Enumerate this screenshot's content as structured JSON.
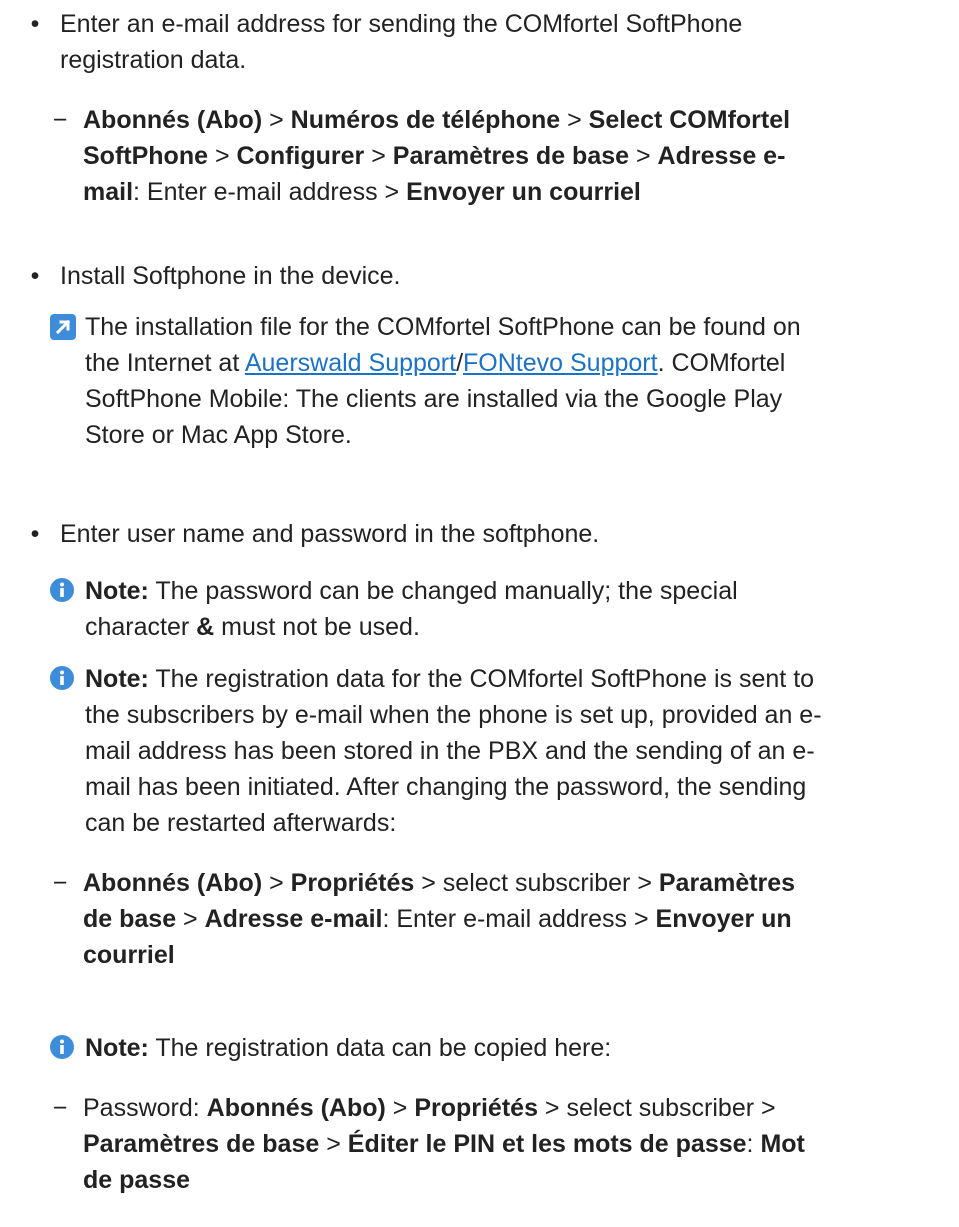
{
  "item1": {
    "bullet": "•",
    "text_line1": "Enter an e-mail address for sending the COMfortel SoftPhone",
    "text_line2": "registration data.",
    "dash": "−",
    "path": {
      "l1_p1": "Abonnés (Abo)",
      "l1_p2": " > ",
      "l1_p3": "Numéros de téléphone",
      "l1_p4": " > ",
      "l1_p5": "Select COMfortel",
      "l2_p1": "SoftPhone",
      "l2_p2": " > ",
      "l2_p3": "Configurer",
      "l2_p4": " > ",
      "l2_p5": "Paramètres de base",
      "l2_p6": " > ",
      "l2_p7": "Adresse e-",
      "l3_p1": "mail",
      "l3_p2": ": Enter e-mail address > ",
      "l3_p3": "Envoyer un courriel"
    }
  },
  "item2": {
    "bullet": "•",
    "text": "Install Softphone in the device.",
    "tip": {
      "icon": "external-link-icon",
      "l1": "The installation file for the COMfortel SoftPhone can be found on",
      "l2_p1": "the Internet at ",
      "link1": "Auerswald Support",
      "slash": "/",
      "link2": "FONtevo Support",
      "l2_p2": ". COMfortel",
      "l3": "SoftPhone Mobile: The clients are installed via the Google Play",
      "l4": "Store or Mac App Store."
    }
  },
  "item3": {
    "bullet": "•",
    "text": "Enter user name and password in the softphone.",
    "note1": {
      "icon": "info-icon",
      "label": "Note:",
      "l1": " The password can be changed manually; the special",
      "l2_p1": "character ",
      "amp": "&",
      "l2_p2": " must not be used."
    },
    "note2": {
      "icon": "info-icon",
      "label": "Note:",
      "l1": " The registration data for the COMfortel SoftPhone is sent to",
      "l2": "the subscribers by e-mail when the phone is set up, provided an e-",
      "l3": "mail address has been stored in the PBX and the sending of an e-",
      "l4": "mail has been initiated. After changing the password, the sending",
      "l5": "can be restarted afterwards:",
      "dash": "−",
      "path": {
        "l1_p1": "Abonnés (Abo)",
        "l1_p2": " > ",
        "l1_p3": "Propriétés",
        "l1_p4": " > select subscriber > ",
        "l1_p5": "Paramètres",
        "l2_p1": "de base",
        "l2_p2": " > ",
        "l2_p3": "Adresse e-mail",
        "l2_p4": ": Enter e-mail address > ",
        "l2_p5": "Envoyer un",
        "l3_p1": "courriel"
      }
    },
    "note3": {
      "icon": "info-icon",
      "label": "Note:",
      "text": " The registration data can be copied here:",
      "dash": "−",
      "path": {
        "l1_p1": "Password: ",
        "l1_p2": "Abonnés (Abo)",
        "l1_p3": " > ",
        "l1_p4": "Propriétés",
        "l1_p5": " > select subscriber >",
        "l2_p1": "Paramètres de base",
        "l2_p2": " > ",
        "l2_p3": "Éditer le PIN et les mots de passe",
        "l2_p4": ": ",
        "l2_p5": "Mot",
        "l3_p1": "de passe"
      }
    }
  }
}
